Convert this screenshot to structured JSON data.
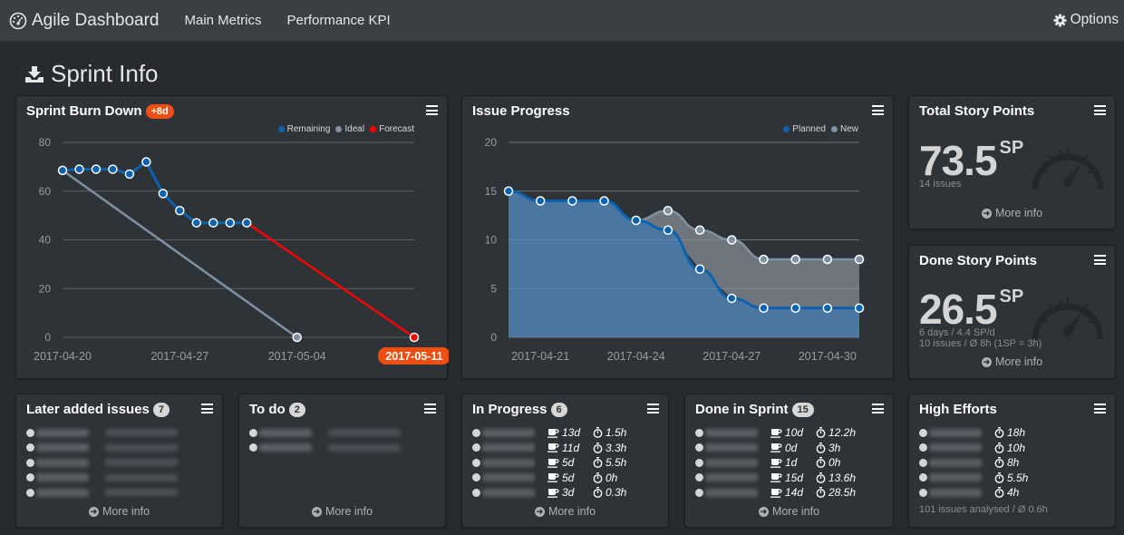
{
  "navbar": {
    "brand": "Agile Dashboard",
    "brand_icon": "dashboard-gauge-icon",
    "links": [
      "Main Metrics",
      "Performance KPI"
    ],
    "options_label": "Options",
    "options_icon": "gear-icon"
  },
  "page": {
    "title": "Sprint Info",
    "title_icon": "download-tray-icon"
  },
  "burndown": {
    "title": "Sprint Burn Down",
    "badge": "+8d",
    "highlight_color": "#f04e10",
    "legend": [
      {
        "label": "Remaining",
        "color": "#0b62b0"
      },
      {
        "label": "Ideal",
        "color": "#7e92a4"
      },
      {
        "label": "Forecast",
        "color": "#ff0000"
      }
    ]
  },
  "issue_progress": {
    "title": "Issue Progress",
    "legend": [
      {
        "label": "Planned",
        "color": "#0b62b0"
      },
      {
        "label": "New",
        "color": "#7e92a4"
      }
    ]
  },
  "chart_data": [
    {
      "type": "line",
      "title": "Sprint Burn Down",
      "x_ticks": [
        "2017-04-20",
        "2017-04-27",
        "2017-05-04",
        "2017-05-11"
      ],
      "highlighted_tick": "2017-05-11",
      "y_ticks": [
        0,
        20,
        40,
        60,
        80
      ],
      "ylim": [
        0,
        80
      ],
      "x_range_days": [
        0,
        21
      ],
      "grid": true,
      "legend_position": "top-right",
      "series": [
        {
          "name": "Remaining",
          "color": "#0b62b0",
          "x_days": [
            0,
            1,
            2,
            3,
            4,
            5,
            6,
            7,
            8,
            9,
            10,
            11
          ],
          "values": [
            68.5,
            69,
            69,
            69,
            67,
            72,
            59,
            52,
            47,
            47,
            47,
            47
          ]
        },
        {
          "name": "Ideal",
          "color": "#7e92a4",
          "x_days": [
            0,
            14
          ],
          "values": [
            68.5,
            0
          ]
        },
        {
          "name": "Forecast",
          "color": "#ff0000",
          "x_days": [
            11,
            21
          ],
          "values": [
            47,
            0
          ]
        }
      ]
    },
    {
      "type": "area",
      "title": "Issue Progress",
      "x_ticks": [
        "2017-04-21",
        "2017-04-24",
        "2017-04-27",
        "2017-04-30"
      ],
      "x": [
        "2017-04-20",
        "2017-04-21",
        "2017-04-22",
        "2017-04-23",
        "2017-04-24",
        "2017-04-25",
        "2017-04-26",
        "2017-04-27",
        "2017-04-28",
        "2017-04-29",
        "2017-04-30",
        "2017-05-01"
      ],
      "y_ticks": [
        0,
        5,
        10,
        15,
        20
      ],
      "ylim": [
        0,
        20
      ],
      "grid": true,
      "legend_position": "top-right",
      "series": [
        {
          "name": "Planned",
          "color": "#0b62b0",
          "values": [
            15,
            14,
            14,
            14,
            12,
            11,
            7,
            4,
            3,
            3,
            3,
            3
          ]
        },
        {
          "name": "New",
          "color": "#7e92a4",
          "start_index": 4,
          "values": [
            12,
            13,
            11,
            10,
            8,
            8,
            8,
            8
          ]
        }
      ]
    }
  ],
  "total_sp": {
    "title": "Total Story Points",
    "value": "73.5",
    "unit": "SP",
    "lines": [
      "14 issues"
    ],
    "more_info": "More info"
  },
  "done_sp": {
    "title": "Done Story Points",
    "value": "26.5",
    "unit": "SP",
    "lines": [
      "6 days / 4.4 SP/d",
      "10 issues / Ø 8h (1SP = 3h)"
    ],
    "more_info": "More info"
  },
  "later_added": {
    "title": "Later added issues",
    "count": "7",
    "rows": 5,
    "more_info": "More info"
  },
  "todo": {
    "title": "To do",
    "count": "2",
    "rows": 2,
    "more_info": "More info"
  },
  "in_progress": {
    "title": "In Progress",
    "count": "6",
    "items": [
      {
        "days": "13d",
        "hours": "1.5h"
      },
      {
        "days": "11d",
        "hours": "3.3h"
      },
      {
        "days": "5d",
        "hours": "5.5h"
      },
      {
        "days": "5d",
        "hours": "0h"
      },
      {
        "days": "3d",
        "hours": "0.3h"
      }
    ],
    "more_info": "More info"
  },
  "done_in_sprint": {
    "title": "Done in Sprint",
    "count": "15",
    "items": [
      {
        "days": "10d",
        "hours": "12.2h"
      },
      {
        "days": "0d",
        "hours": "3h"
      },
      {
        "days": "1d",
        "hours": "0h"
      },
      {
        "days": "15d",
        "hours": "13.6h"
      },
      {
        "days": "14d",
        "hours": "28.5h"
      }
    ],
    "more_info": "More info"
  },
  "high_efforts": {
    "title": "High Efforts",
    "items": [
      {
        "hours": "18h"
      },
      {
        "hours": "10h"
      },
      {
        "hours": "8h"
      },
      {
        "hours": "5.5h"
      },
      {
        "hours": "4h"
      }
    ],
    "footer": "101 issues analysed / Ø 0.6h"
  }
}
